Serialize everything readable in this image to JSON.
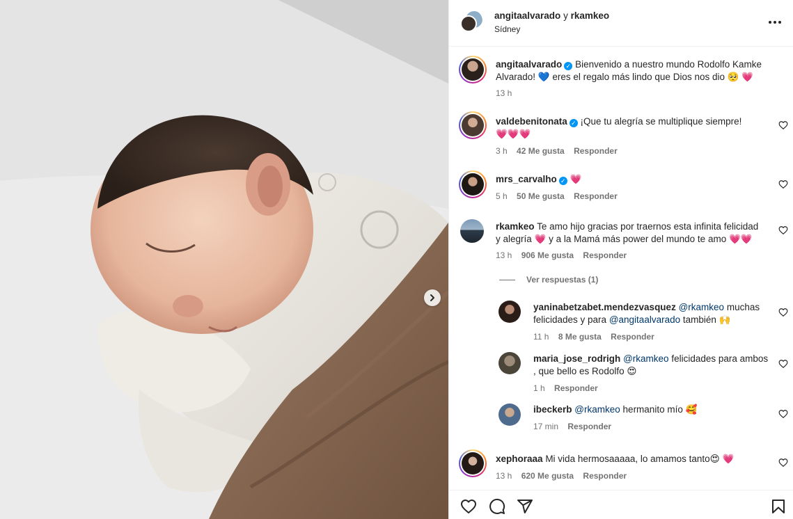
{
  "header": {
    "username": "angitaalvarado",
    "connector": "y",
    "collaborator": "rkamkeo",
    "location": "Sídney",
    "more_icon": "ellipsis-icon"
  },
  "caption": {
    "username": "angitaalvarado",
    "text_line1": "Bienvenido a nuestro mundo Rodolfo Kamke",
    "text_line2": "Alvarado! 💙 eres el regalo más lindo que Dios nos dio 🥺 💗",
    "time": "13 h"
  },
  "comments": [
    {
      "username": "valdebenitonata",
      "verified": true,
      "text_line1": "¡Que tu alegría se multiplique siempre!",
      "text_line2": "💗💗💗",
      "time": "3 h",
      "likes": "42 Me gusta",
      "reply": "Responder"
    },
    {
      "username": "mrs_carvalho",
      "verified": true,
      "text_line1": "💗",
      "time": "5 h",
      "likes": "50 Me gusta",
      "reply": "Responder"
    },
    {
      "username": "rkamkeo",
      "verified": false,
      "text_line1": "Te amo hijo gracias por traernos esta infinita felicidad",
      "text_line2": "y alegría 💗 y a la Mamá más power del mundo te amo 💗💗",
      "time": "13 h",
      "likes": "906 Me gusta",
      "reply": "Responder"
    }
  ],
  "view_replies": "Ver respuestas (1)",
  "replies": [
    {
      "username": "yaninabetzabet.mendezvasquez",
      "mention1": "@rkamkeo",
      "text_a": "muchas",
      "text_b": "felicidades y para",
      "mention2": "@angitaalvarado",
      "text_c": "también 🙌",
      "time": "11 h",
      "likes": "8 Me gusta",
      "reply": "Responder"
    },
    {
      "username": "maria_jose_rodrigh",
      "mention1": "@rkamkeo",
      "text_a": "felicidades para ambos",
      "text_b": ", que bello es Rodolfo 😍",
      "time": "1 h",
      "reply": "Responder"
    },
    {
      "username": "ibeckerb",
      "mention1": "@rkamkeo",
      "text_a": "hermanito mío 🥰",
      "time": "17 min",
      "reply": "Responder"
    }
  ],
  "last_comment": {
    "username": "xephoraaa",
    "text": "Mi vida hermosaaaaa, lo amamos tanto😍 💗",
    "time": "13 h",
    "likes": "620 Me gusta",
    "reply": "Responder"
  },
  "actions": {
    "like_icon": "heart-outline-icon",
    "comment_icon": "comment-bubble-icon",
    "share_icon": "paper-plane-icon",
    "save_icon": "bookmark-icon"
  },
  "colors": {
    "verified": "#0095f6",
    "mention": "#00376b",
    "meta": "#737373",
    "border": "#efefef"
  }
}
